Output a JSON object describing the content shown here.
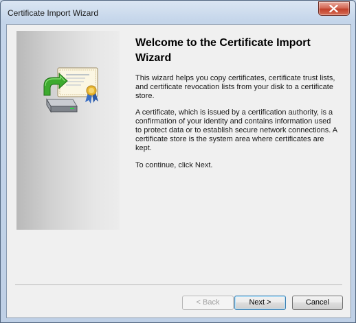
{
  "window": {
    "title": "Certificate Import Wizard"
  },
  "side_panel": {
    "illustration_icon": "certificate-import-icon"
  },
  "content": {
    "heading": "Welcome to the Certificate Import Wizard",
    "paragraph1": "This wizard helps you copy certificates, certificate trust lists, and certificate revocation lists from your disk to a certificate store.",
    "paragraph2": "A certificate, which is issued by a certification authority, is a confirmation of your identity and contains information used to protect data or to establish secure network connections. A certificate store is the system area where certificates are kept.",
    "paragraph3": "To continue, click Next."
  },
  "buttons": {
    "back_label": "< Back",
    "back_enabled": false,
    "next_label": "Next >",
    "cancel_label": "Cancel"
  },
  "colors": {
    "titlebar": "#c4d5ea",
    "close_button": "#c1412b",
    "dialog_background": "#f0f0f0",
    "next_button_focus": "#3c7fb1"
  }
}
